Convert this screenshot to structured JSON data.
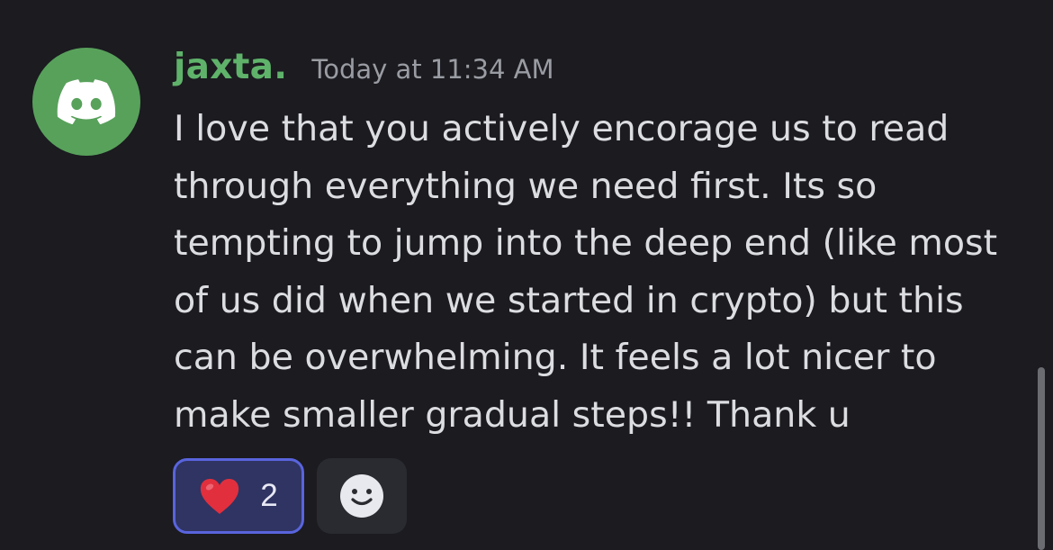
{
  "message": {
    "avatar_icon": "discord-logo-icon",
    "avatar_color": "#58a15b",
    "username": "jaxta.",
    "username_color": "#5fb26a",
    "timestamp": "Today at 11:34 AM",
    "lines": [
      "I love that you actively encorage us to read",
      "through everything we need first. Its so",
      "tempting to jump into the deep end (like most",
      "of us did when we started in crypto) but this",
      "can be overwhelming. It feels a lot nicer to",
      "make smaller gradual steps!! Thank u"
    ]
  },
  "reactions": [
    {
      "emoji": "❤️",
      "icon": "red-heart-icon",
      "count": "2",
      "active": true
    }
  ],
  "add_reaction": {
    "icon": "add-reaction-smiley-icon"
  },
  "colors": {
    "background": "#1b1b20",
    "reaction_active_bg": "#2f3462",
    "reaction_active_border": "#5964dd",
    "add_reaction_bg": "#2a2b31"
  }
}
